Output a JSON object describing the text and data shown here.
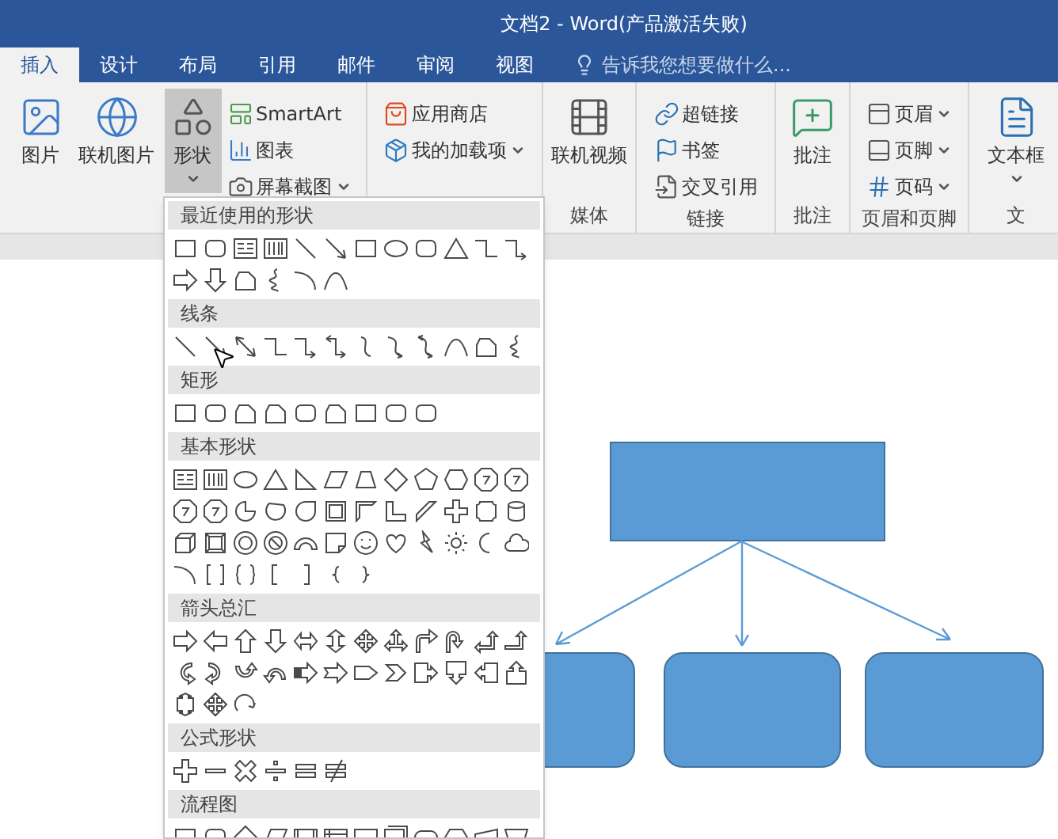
{
  "window": {
    "title": "文档2 - Word(产品激活失败)"
  },
  "tabs": [
    {
      "label": "插入",
      "selected": true
    },
    {
      "label": "设计",
      "selected": false
    },
    {
      "label": "布局",
      "selected": false
    },
    {
      "label": "引用",
      "selected": false
    },
    {
      "label": "邮件",
      "selected": false
    },
    {
      "label": "审阅",
      "selected": false
    },
    {
      "label": "视图",
      "selected": false
    }
  ],
  "tell_me": {
    "placeholder": "告诉我您想要做什么..."
  },
  "ribbon": {
    "groups": [
      {
        "items": [
          {
            "kind": "large",
            "label": "图片",
            "selected": false,
            "dropdown": false
          },
          {
            "kind": "large",
            "label": "联机图片",
            "selected": false,
            "dropdown": false
          },
          {
            "kind": "large",
            "label": "形状",
            "selected": true,
            "dropdown": true
          },
          {
            "kind": "small",
            "label": "SmartArt",
            "selected": false,
            "dropdown": false
          },
          {
            "kind": "small",
            "label": "图表",
            "selected": false,
            "dropdown": false
          },
          {
            "kind": "small",
            "label": "屏幕截图",
            "selected": false,
            "dropdown": true
          }
        ]
      },
      {
        "items": [
          {
            "kind": "small",
            "label": "应用商店",
            "selected": false,
            "dropdown": false
          },
          {
            "kind": "small",
            "label": "我的加载项",
            "selected": false,
            "dropdown": true
          }
        ]
      },
      {
        "label": "媒体",
        "items": [
          {
            "kind": "large",
            "label": "联机视频",
            "selected": false,
            "dropdown": false
          }
        ]
      },
      {
        "label": "链接",
        "items": [
          {
            "kind": "small",
            "label": "超链接",
            "selected": false,
            "dropdown": false
          },
          {
            "kind": "small",
            "label": "书签",
            "selected": false,
            "dropdown": false
          },
          {
            "kind": "small",
            "label": "交叉引用",
            "selected": false,
            "dropdown": false
          }
        ]
      },
      {
        "label": "批注",
        "items": [
          {
            "kind": "large",
            "label": "批注",
            "selected": false,
            "dropdown": false
          }
        ]
      },
      {
        "label": "页眉和页脚",
        "items": [
          {
            "kind": "small",
            "label": "页眉",
            "selected": false,
            "dropdown": true
          },
          {
            "kind": "small",
            "label": "页脚",
            "selected": false,
            "dropdown": true
          },
          {
            "kind": "small",
            "label": "页码",
            "selected": false,
            "dropdown": true
          }
        ]
      },
      {
        "label": "文",
        "items": [
          {
            "kind": "large",
            "label": "文本框",
            "selected": false,
            "dropdown": true
          }
        ]
      }
    ]
  },
  "shape_menu": {
    "sections": [
      {
        "title": "最近使用的形状"
      },
      {
        "title": "线条"
      },
      {
        "title": "矩形"
      },
      {
        "title": "基本形状"
      },
      {
        "title": "箭头总汇"
      },
      {
        "title": "公式形状"
      },
      {
        "title": "流程图"
      }
    ]
  }
}
